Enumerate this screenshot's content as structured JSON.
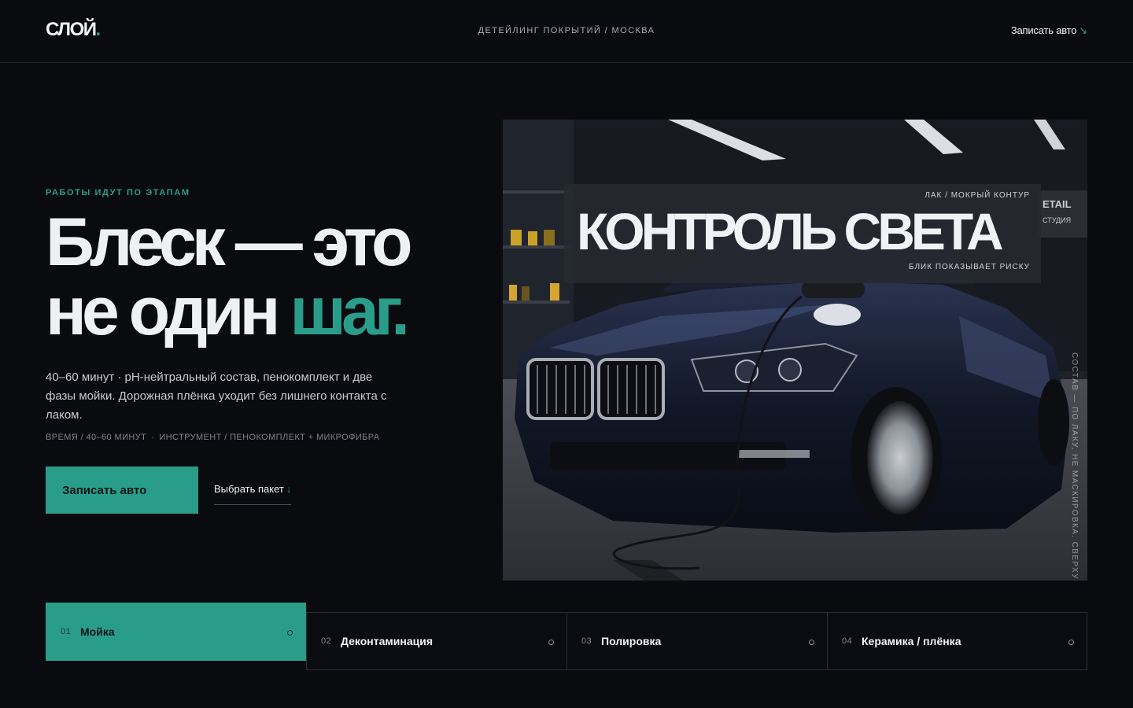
{
  "header": {
    "logo_text": "СЛОЙ",
    "logo_dot": ".",
    "tagline": "ДЕТЕЙЛИНГ ПОКРЫТИЙ / МОСКВА",
    "cta_label": "Записать авто",
    "cta_arrow": "↘"
  },
  "hero": {
    "eyebrow": "РАБОТЫ ИДУТ ПО ЭТАПАМ",
    "headline_line1": "Блеск — это",
    "headline_line2_a": "не один ",
    "headline_line2_b": "шаг.",
    "lead": "40–60 минут · pH-нейтральный состав, пенокомплект и две фазы мойки. Дорожная плёнка уходит без лишнего контакта с лаком.",
    "meta_time": "ВРЕМЯ / 40–60 МИНУТ",
    "meta_sep": "·",
    "meta_tools": "ИНСТРУМЕНТ / ПЕНОКОМПЛЕКТ + МИКРОФИБРА",
    "primary_button": "Записать авто",
    "secondary_link": "Выбрать пакет",
    "secondary_arrow": "↓"
  },
  "image": {
    "panel_top": "ЛАК / МОКРЫЙ КОНТУР",
    "panel_title": "КОНТРОЛЬ СВЕТА",
    "panel_bottom": "БЛИК ПОКАЗЫВАЕТ РИСКУ",
    "vertical_caption": "СОСТАВ — ПО ЛАКУ, НЕ МАСКИРОВКА. СВЕРХУ",
    "sign_text_1": "ETAIL",
    "sign_text_2": "СТУДИЯ"
  },
  "steps": [
    {
      "num": "01",
      "label": "Мойка",
      "active": true
    },
    {
      "num": "02",
      "label": "Деконтаминация",
      "active": false
    },
    {
      "num": "03",
      "label": "Полировка",
      "active": false
    },
    {
      "num": "04",
      "label": "Керамика / плёнка",
      "active": false
    }
  ],
  "colors": {
    "accent": "#2a9d8a",
    "background": "#0a0b0f",
    "text": "#eef0f3"
  }
}
